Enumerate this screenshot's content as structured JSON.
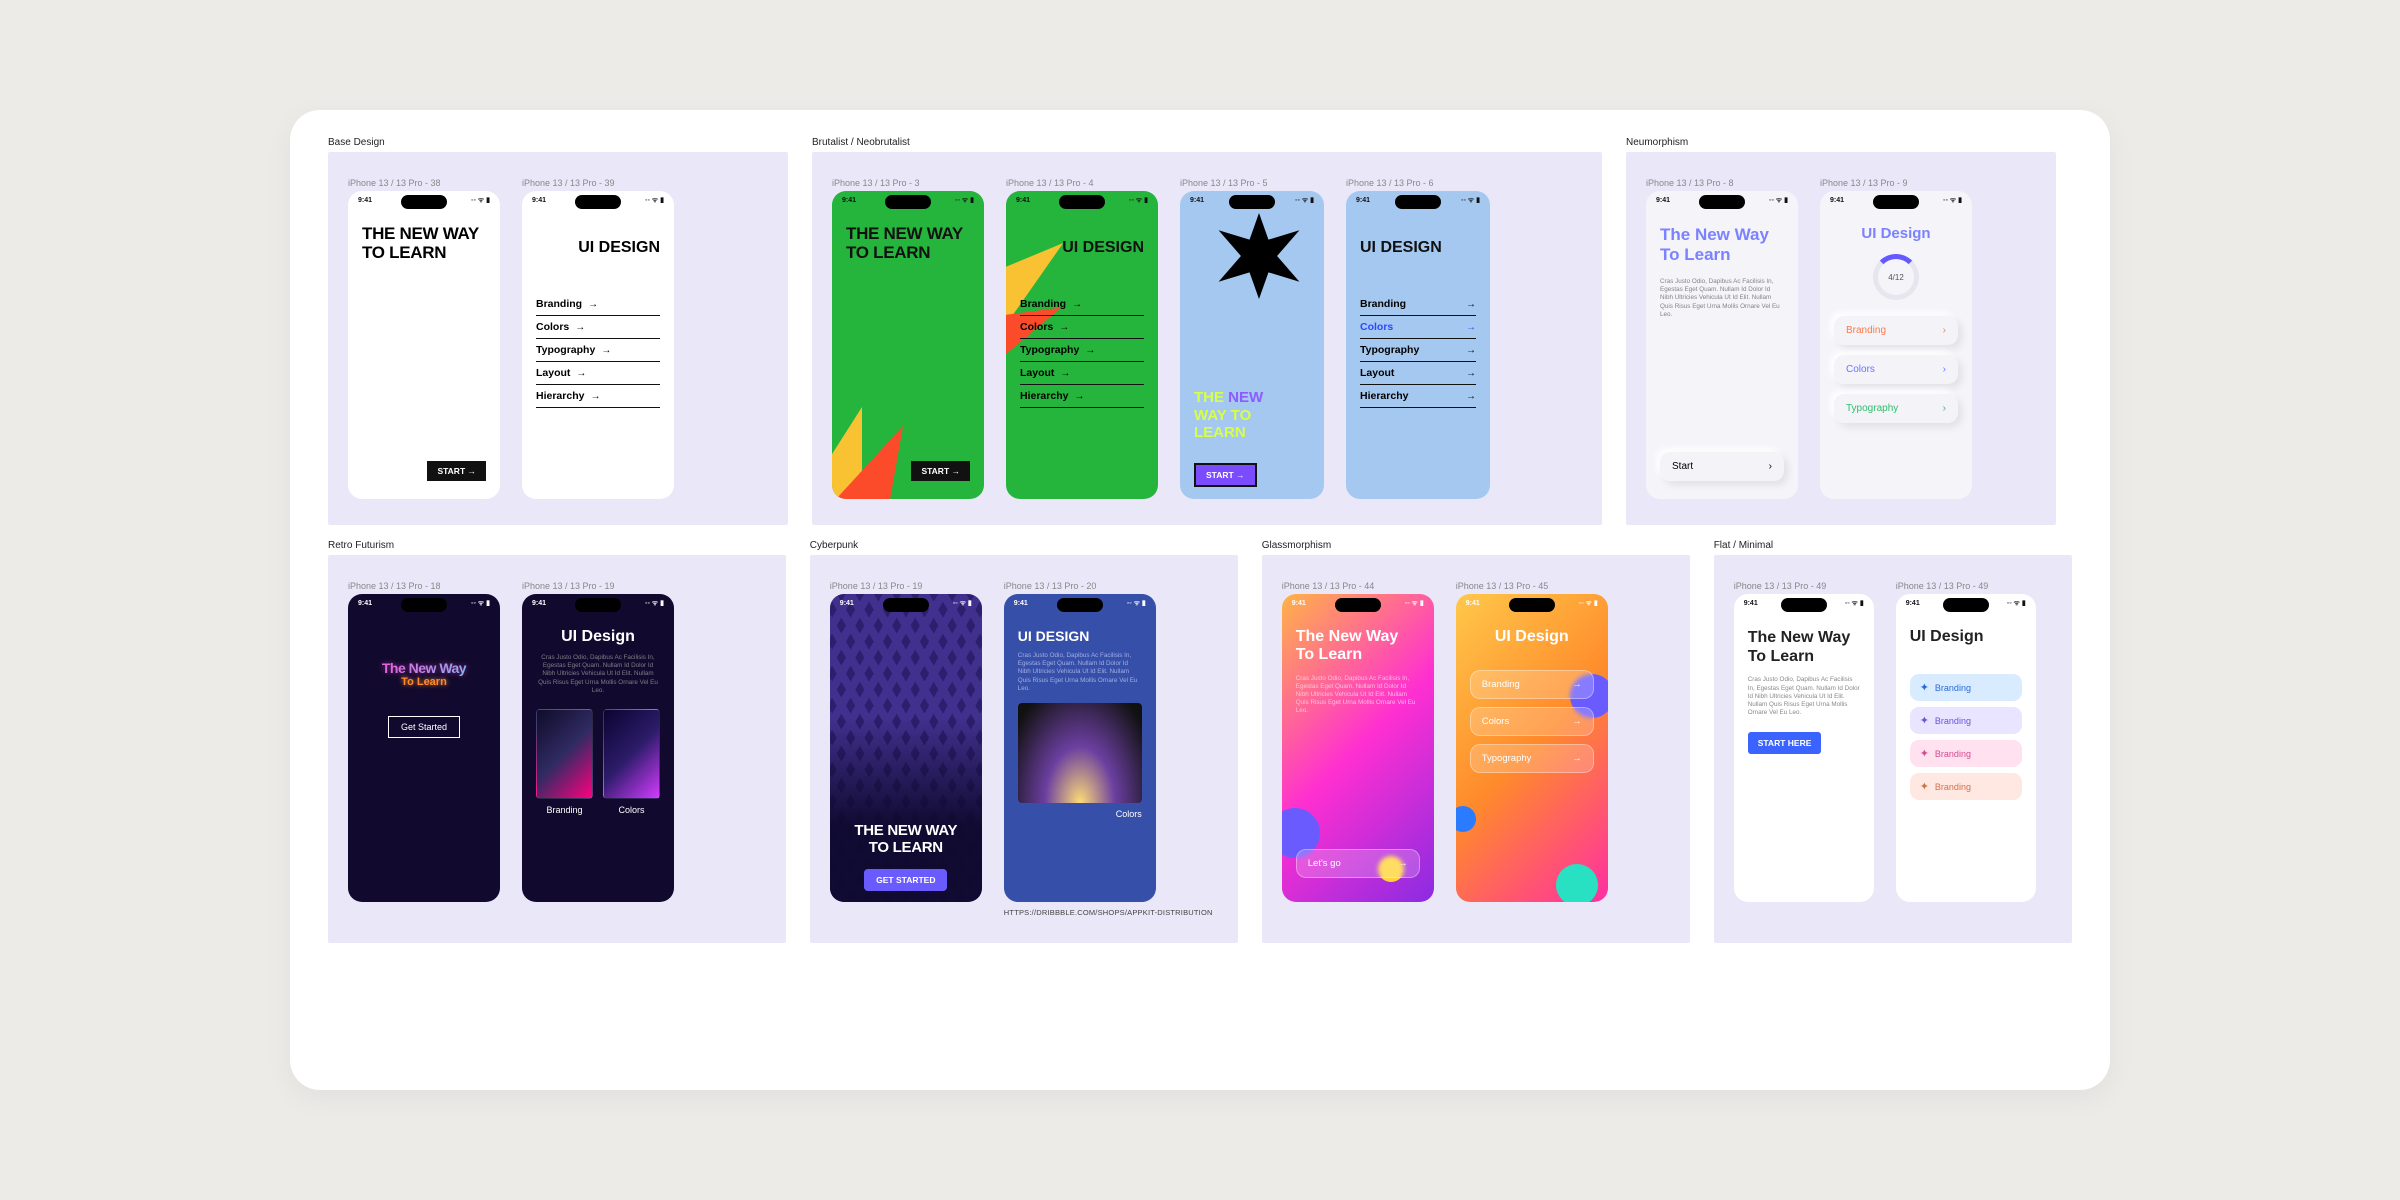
{
  "statusbar": {
    "time": "9:41",
    "icons": "◦◦ ᯤ ▮"
  },
  "common": {
    "title_caps": "THE NEW WAY TO LEARN",
    "title_mixed": "The New Way To Learn",
    "ui_design_caps": "UI DESIGN",
    "ui_design_mixed": "UI Design",
    "lorem": "Cras Justo Odio, Dapibus Ac Facilisis In, Egestas Eget Quam. Nullam Id Dolor Id Nibh Ultricies Vehicula Ut Id Elit. Nullam Quis Risus Eget Urna Mollis Ornare Vel Eu Leo.",
    "menu": {
      "branding": "Branding",
      "colors": "Colors",
      "typography": "Typography",
      "layout": "Layout",
      "hierarchy": "Hierarchy"
    },
    "arrow": "→"
  },
  "base": {
    "label": "Base Design",
    "frames": [
      "iPhone 13 / 13 Pro - 38",
      "iPhone 13 / 13 Pro - 39"
    ],
    "start_btn": "START →"
  },
  "brutalist": {
    "label": "Brutalist / Neobrutalist",
    "frames": [
      "iPhone 13 / 13 Pro - 3",
      "iPhone 13 / 13 Pro - 4",
      "iPhone 13 / 13 Pro - 5",
      "iPhone 13 / 13 Pro - 6"
    ],
    "start_btn": "START →",
    "colored_title": {
      "THE": "THE",
      "NEW": "NEW",
      "WAYTO": "WAY TO",
      "LEARN": "LEARN"
    }
  },
  "neumorphism": {
    "label": "Neumorphism",
    "frames": [
      "iPhone 13 / 13 Pro - 8",
      "iPhone 13 / 13 Pro - 9"
    ],
    "start_btn": "Start",
    "progress": "4/12"
  },
  "retro": {
    "label": "Retro Futurism",
    "frames": [
      "iPhone 13 / 13 Pro - 18",
      "iPhone 13 / 13 Pro - 19"
    ],
    "title": "The New Way",
    "subtitle": "To Learn",
    "start_btn": "Get Started",
    "cards": [
      "Branding",
      "Colors"
    ]
  },
  "cyberpunk": {
    "label": "Cyberpunk",
    "frames": [
      "iPhone 13 / 13 Pro - 19",
      "iPhone 13 / 13 Pro - 20"
    ],
    "start_btn": "GET STARTED",
    "card": "Colors",
    "credit": "HTTPS://DRIBBBLE.COM/SHOPS/APPKIT-DISTRIBUTION"
  },
  "glass": {
    "label": "Glassmorphism",
    "frames": [
      "iPhone 13 / 13 Pro - 44",
      "iPhone 13 / 13 Pro - 45"
    ],
    "start_btn": "Let's go"
  },
  "flat": {
    "label": "Flat / Minimal",
    "frames": [
      "iPhone 13 / 13 Pro - 49",
      "iPhone 13 / 13 Pro - 49"
    ],
    "start_btn": "START HERE",
    "item": "Branding",
    "dot": "✦"
  }
}
